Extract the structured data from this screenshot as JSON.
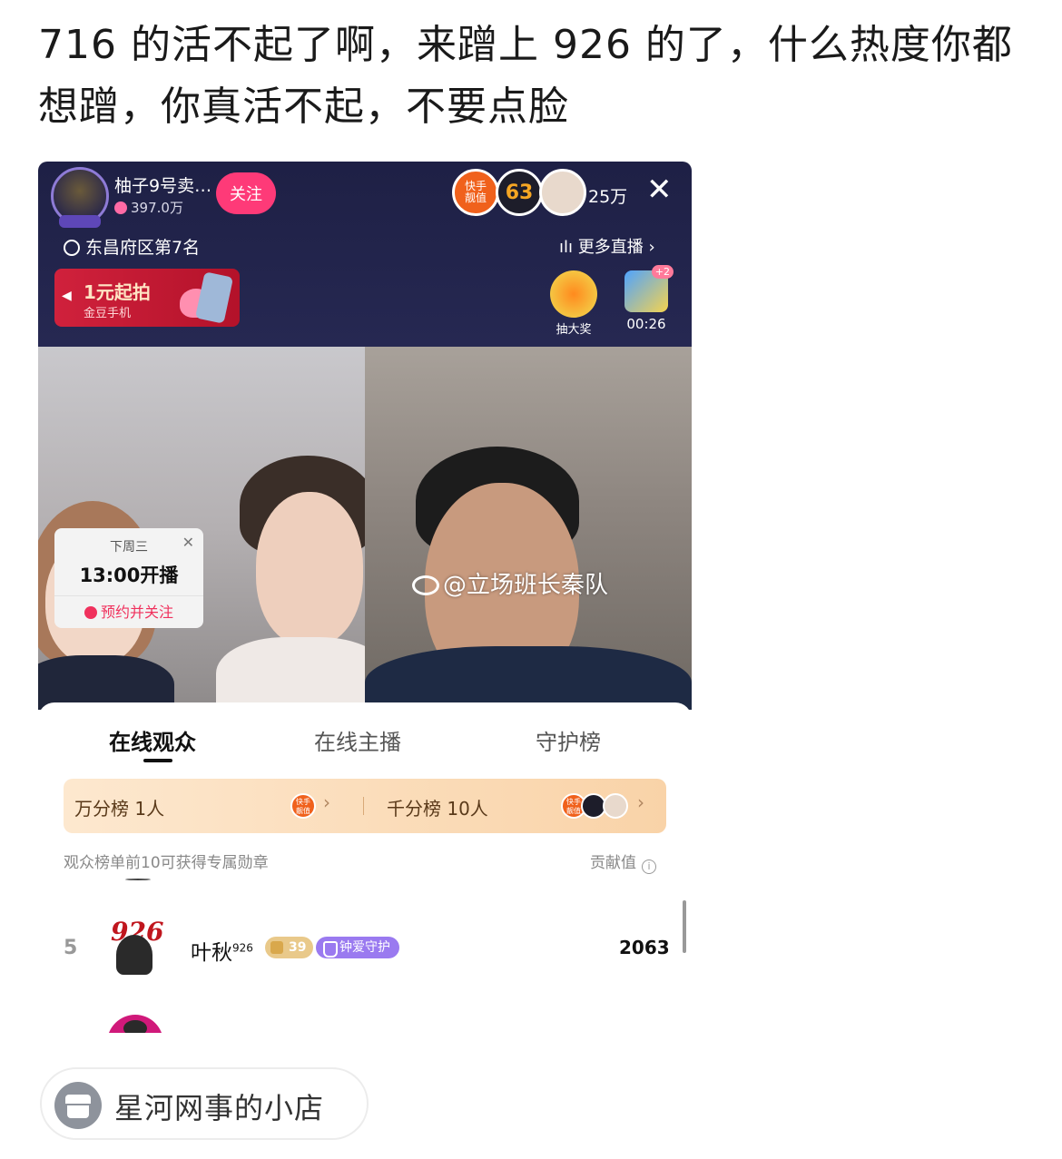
{
  "post": {
    "text": "716 的活不起了啊，来蹭上 926 的了，什么热度你都想蹭，你真活不起，不要点脸"
  },
  "live": {
    "host_name": "柚子9号卖…",
    "host_likes": "397.0万",
    "follow_label": "关注",
    "top_badge_1": "快手\n靓值",
    "top_badge_2": "63",
    "viewer_count": "25万",
    "close_icon": "close-icon",
    "rank_text": "东昌府区第7名",
    "more_live_label": "ılı 更多直播 ›",
    "promo_title": "1元起拍",
    "promo_sub": "金豆手机",
    "lottery_label": "抽大奖",
    "timer_badge": "+2",
    "timer_label": "00:26"
  },
  "schedule": {
    "day": "下周三",
    "time": "13:00开播",
    "action": "预约并关注"
  },
  "watermark": "@立场班长秦队",
  "panel": {
    "tabs": [
      "在线观众",
      "在线主播",
      "守护榜"
    ],
    "rank_left_label": "万分榜",
    "rank_left_count": "1人",
    "rank_right_label": "千分榜",
    "rank_right_count": "10人",
    "mini_badge": "快手\n靓值",
    "hint": "观众榜单前10可获得专属勋章",
    "contrib_label": "贡献值",
    "row": {
      "rank": "5",
      "avatar_num": "926",
      "name": "叶秋",
      "name_sup": "926",
      "level": "39",
      "guard_label": "钟爱守护",
      "score": "2063"
    }
  },
  "shop": {
    "label": "星河网事的小店"
  },
  "colors": {
    "live_header_bg": "#1e2045",
    "follow_btn": "#fe3a78",
    "promo_bg": "#d0213c",
    "rank_bar_bg": "#f9d3a8",
    "guard_badge": "#9a7af0"
  }
}
